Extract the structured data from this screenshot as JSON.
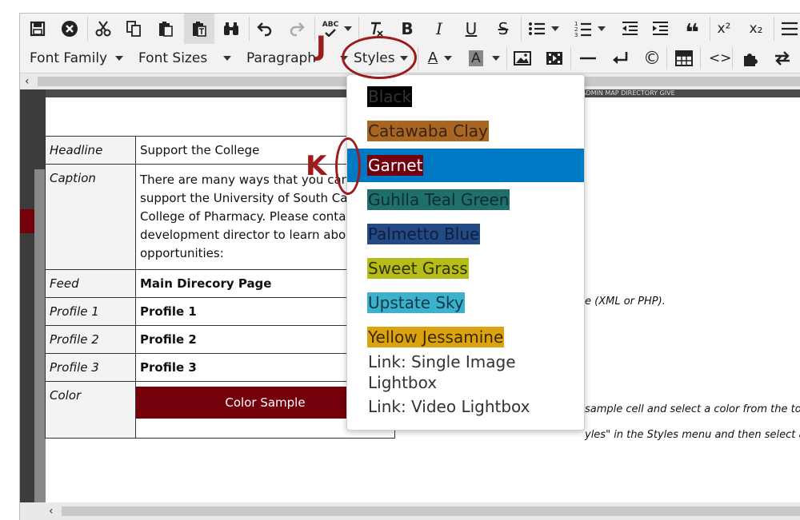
{
  "toolbar": {
    "font_family_label": "Font Family",
    "font_sizes_label": "Font Sizes",
    "paragraph_label": "Paragraph",
    "styles_label": "Styles",
    "spellcheck_glyph": "ABC",
    "copyright_glyph": "©",
    "superscript_glyph": "x²",
    "subscript_glyph": "x₂",
    "quote_glyph": "❝"
  },
  "styles_menu": {
    "items": [
      {
        "label": "Black",
        "bg": "#000000",
        "fg": "#333333"
      },
      {
        "label": "Catawaba Clay",
        "bg": "#a86624",
        "fg": "#3a2410"
      },
      {
        "label": "Garnet",
        "bg": "#73000a",
        "fg": "#ffffff"
      },
      {
        "label": "Guhlla Teal Green",
        "bg": "#1f6f6c",
        "fg": "#0e2e2d"
      },
      {
        "label": "Palmetto Blue",
        "bg": "#234a85",
        "fg": "#0f1f3a"
      },
      {
        "label": "Sweet Grass",
        "bg": "#b5bd1b",
        "fg": "#333300"
      },
      {
        "label": "Upstate Sky",
        "bg": "#3cb1ce",
        "fg": "#0f3a45"
      },
      {
        "label": "Yellow Jessamine",
        "bg": "#dca310",
        "fg": "#3b2a00"
      },
      {
        "label": "Link: Single Image Lightbox",
        "bg": "",
        "fg": "#333333"
      },
      {
        "label": "Link: Video Lightbox",
        "bg": "",
        "fg": "#333333"
      }
    ],
    "selected_index": 2,
    "selected_color": "#0079c4"
  },
  "table": {
    "rows": [
      {
        "label": "Headline",
        "value": "Support the College"
      },
      {
        "label": "Caption",
        "value": "There are many ways that you can support the University of South Ca College of Pharmacy. Please conta development director to learn abo giving opportunities:"
      },
      {
        "label": "Feed",
        "value": "Main Direcory Page"
      },
      {
        "label": "Profile 1",
        "value": "Profile 1"
      },
      {
        "label": "Profile 2",
        "value": "Profile 2"
      },
      {
        "label": "Profile 3",
        "value": "Profile 3"
      },
      {
        "label": "Color",
        "value": "Color Sample"
      }
    ],
    "color_sample_bg": "#73000a"
  },
  "notes": {
    "feed_note": "e (XML or PHP).",
    "color_note_1": "sample cell and select a color from the toolb",
    "color_note_2": "yles\" in the Styles menu and then select anot",
    "banner_text": "ADMIN   MAP   DIRECTORY   GIVE"
  },
  "annotations": {
    "j_letter": "J",
    "k_letter": "K",
    "color": "#9e1b1b"
  }
}
